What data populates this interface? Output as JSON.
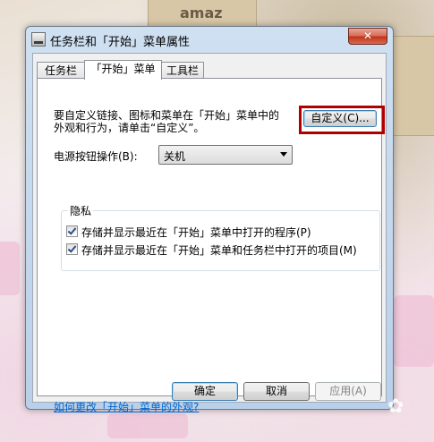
{
  "background": {
    "box_text": "amaz"
  },
  "window": {
    "title": "任务栏和「开始」菜单属性",
    "close_symbol": "✕"
  },
  "tabs": [
    {
      "label": "任务栏",
      "active": false
    },
    {
      "label": "「开始」菜单",
      "active": true
    },
    {
      "label": "工具栏",
      "active": false
    }
  ],
  "start_menu": {
    "intro_text": "要自定义链接、图标和菜单在「开始」菜单中的外观和行为，请单击“自定义”。",
    "customize_button": "自定义(C)...",
    "power_label": "电源按钮操作(B):",
    "power_value": "关机",
    "privacy": {
      "title": "隐私",
      "items": [
        {
          "label": "存储并显示最近在「开始」菜单中打开的程序(P)",
          "checked": true
        },
        {
          "label": "存储并显示最近在「开始」菜单和任务栏中打开的项目(M)",
          "checked": true
        }
      ]
    },
    "help_link": "如何更改「开始」菜单的外观?"
  },
  "buttons": {
    "ok": "确定",
    "cancel": "取消",
    "apply": "应用(A)"
  },
  "colors": {
    "highlight": "#b00000",
    "link": "#0066cc"
  }
}
